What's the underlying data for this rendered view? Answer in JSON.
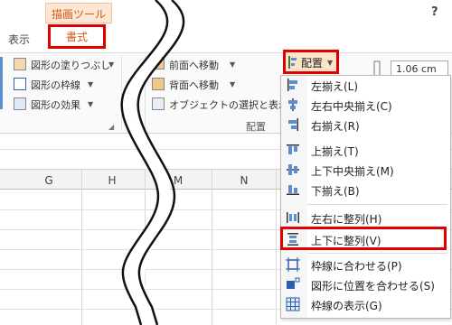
{
  "tabs": {
    "context_group": "描画ツール",
    "view": "表示",
    "format": "書式",
    "help": "?"
  },
  "ribbon": {
    "shape_styles": [
      {
        "label": "図形の塗りつぶし",
        "icon": "paint-bucket-icon"
      },
      {
        "label": "図形の枠線",
        "icon": "pen-outline-icon"
      },
      {
        "label": "図形の効果",
        "icon": "shape-effects-icon"
      }
    ],
    "arrange": [
      {
        "label": "前面へ移動",
        "icon": "bring-forward-icon"
      },
      {
        "label": "背面へ移動",
        "icon": "send-backward-icon"
      },
      {
        "label": "オブジェクトの選択と表示",
        "icon": "selection-pane-icon"
      }
    ],
    "arrange_group_label": "配置",
    "align_button": "配置",
    "height_value": "1.06 cm"
  },
  "sheet": {
    "columns": [
      "G",
      "H",
      "M",
      "N"
    ]
  },
  "menu": {
    "items": [
      {
        "label": "左揃え(L)",
        "icon": "align-left-icon"
      },
      {
        "label": "左右中央揃え(C)",
        "icon": "align-center-icon"
      },
      {
        "label": "右揃え(R)",
        "icon": "align-right-icon"
      },
      {
        "label": "上揃え(T)",
        "icon": "align-top-icon"
      },
      {
        "label": "上下中央揃え(M)",
        "icon": "align-middle-icon"
      },
      {
        "label": "下揃え(B)",
        "icon": "align-bottom-icon"
      },
      {
        "label": "左右に整列(H)",
        "icon": "distribute-horizontal-icon"
      },
      {
        "label": "上下に整列(V)",
        "icon": "distribute-vertical-icon"
      },
      {
        "label": "枠線に合わせる(P)",
        "icon": "snap-to-grid-icon"
      },
      {
        "label": "図形に位置を合わせる(S)",
        "icon": "snap-to-shape-icon"
      },
      {
        "label": "枠線の表示(G)",
        "icon": "view-gridlines-icon"
      }
    ]
  },
  "colors": {
    "accent_orange": "#d35a14",
    "highlight_red": "#e00000",
    "context_tab_bg": "#fbe7d3"
  }
}
